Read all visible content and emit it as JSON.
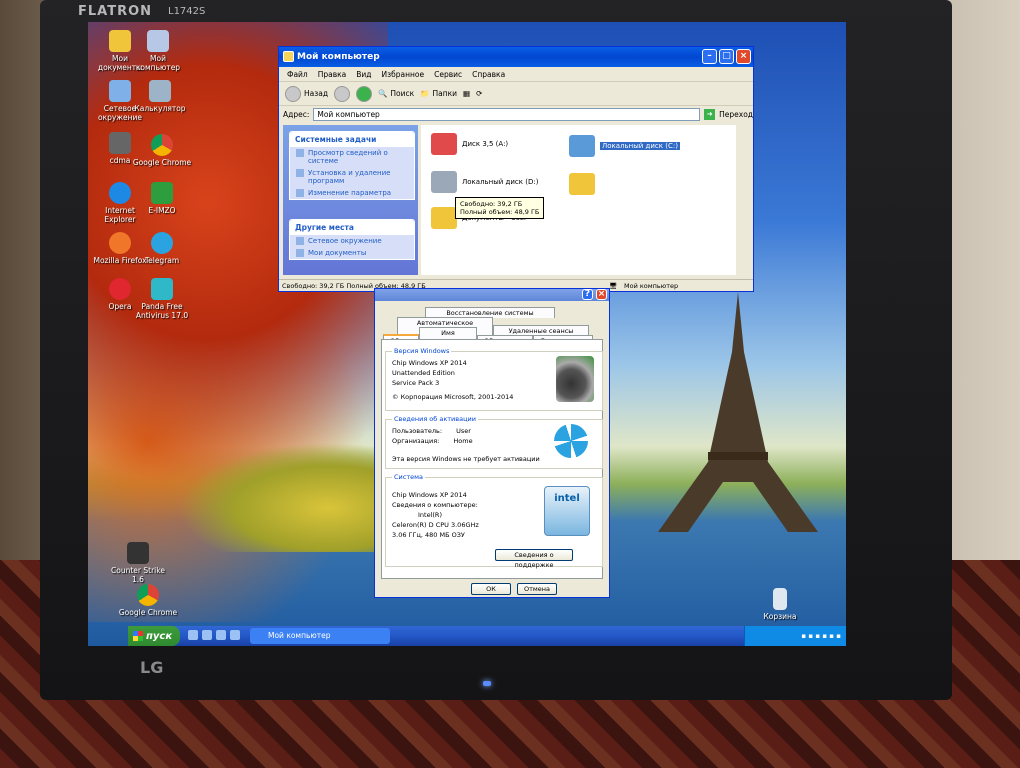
{
  "monitor": {
    "brand": "FLATRON",
    "model": "L1742S",
    "logo": "LG"
  },
  "desktop_icons": [
    {
      "label": "Мои документы",
      "icon": "folder-icon"
    },
    {
      "label": "Мой компьютер",
      "icon": "computer-icon"
    },
    {
      "label": "Сетевое окружение",
      "icon": "network-icon"
    },
    {
      "label": "Калькулятор",
      "icon": "calculator-icon"
    },
    {
      "label": "cdma",
      "icon": "phone-icon"
    },
    {
      "label": "Google Chrome",
      "icon": "chrome-icon"
    },
    {
      "label": "Internet Explorer",
      "icon": "ie-icon"
    },
    {
      "label": "E-IMZO",
      "icon": "eimzo-icon"
    },
    {
      "label": "Mozilla Firefox",
      "icon": "firefox-icon"
    },
    {
      "label": "Telegram",
      "icon": "telegram-icon"
    },
    {
      "label": "Opera",
      "icon": "opera-icon"
    },
    {
      "label": "Panda Free Antivirus 17.0",
      "icon": "panda-icon"
    },
    {
      "label": "Counter Strike 1.6",
      "icon": "cs-icon"
    },
    {
      "label": "Google Chrome",
      "icon": "chrome-icon"
    },
    {
      "label": "Корзина",
      "icon": "recycle-bin-icon"
    }
  ],
  "explorer": {
    "title": "Мой компьютер",
    "menu": [
      "Файл",
      "Правка",
      "Вид",
      "Избранное",
      "Сервис",
      "Справка"
    ],
    "toolbar": {
      "back": "Назад",
      "search": "Поиск",
      "folders": "Папки"
    },
    "address_label": "Адрес:",
    "address_value": "Мой компьютер",
    "go_label": "Переход",
    "tasks": {
      "title": "Системные задачи",
      "items": [
        "Просмотр сведений о системе",
        "Установка и удаление программ",
        "Изменение параметра"
      ]
    },
    "places": {
      "title": "Другие места",
      "items": [
        "Сетевое окружение",
        "Мои документы"
      ]
    },
    "items": [
      {
        "label": "Диск 3,5 (A:)"
      },
      {
        "label": "Локальный диск (C:)"
      },
      {
        "label": "Локальный диск (D:)"
      },
      {
        "label": "Документы - User"
      }
    ],
    "tooltip": {
      "free": "Свободно: 39,2 ГБ",
      "total": "Полный объем: 48,9 ГБ"
    },
    "status_left": "Свободно: 39,2 ГБ Полный объем: 48,9 ГБ",
    "status_right": "Мой компьютер"
  },
  "sysprops": {
    "tabs_row1": [
      "Восстановление системы"
    ],
    "tabs_row2": [
      "Автоматическое обновление",
      "Удаленные сеансы"
    ],
    "tabs_row3": [
      "Общие",
      "Имя компьютера",
      "Оборудование",
      "Дополнительно"
    ],
    "version_title": "Версия Windows",
    "version_lines": [
      "Chip Windows XP 2014",
      "Unattended Edition",
      "Service Pack 3",
      "© Корпорация Microsoft, 2001-2014"
    ],
    "activation_title": "Сведения об активации",
    "user_label": "Пользователь:",
    "user_value": "User",
    "org_label": "Организация:",
    "org_value": "Home",
    "activation_note": "Эта версия Windows не требует активации",
    "system_title": "Система",
    "system_lines": [
      "Chip Windows XP 2014",
      "Сведения о компьютере:",
      "Intel(R)",
      "Celeron(R) D CPU 3.06GHz",
      "3.06 ГГц, 480 МБ ОЗУ"
    ],
    "support_button": "Сведения о поддержке",
    "ok": "ОК",
    "cancel": "Отмена"
  },
  "taskbar": {
    "start": "пуск",
    "task": "Мой компьютер"
  }
}
